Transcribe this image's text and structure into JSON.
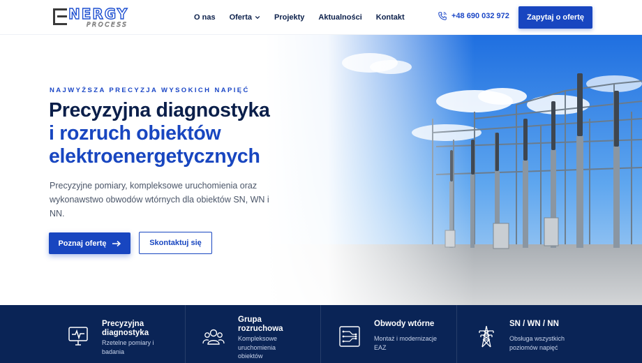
{
  "brand": {
    "logo_word": "NERGY",
    "logo_sub": "PROCESS"
  },
  "nav": {
    "items": [
      {
        "label": "O nas"
      },
      {
        "label": "Oferta",
        "has_dropdown": true
      },
      {
        "label": "Projekty"
      },
      {
        "label": "Aktualności"
      },
      {
        "label": "Kontakt"
      }
    ]
  },
  "header": {
    "phone": "+48 690 032 972",
    "phone_icon": "phone-icon",
    "cta_label": "Zapytaj o ofertę"
  },
  "hero": {
    "eyebrow": "NAJWYŻSZA PRECYZJA WYSOKICH NAPIĘĆ",
    "title_line1": "Precyzyjna diagnostyka",
    "title_line2": "i rozruch obiektów",
    "title_line3": "elektroenergetycznych",
    "lead": "Precyzyjne pomiary, kompleksowe uruchomienia oraz wykonawstwo obwodów wtórnych dla obiektów SN, WN i NN.",
    "primary_button": "Poznaj ofertę",
    "primary_button_icon": "arrow-right-icon",
    "secondary_button": "Skontaktuj się"
  },
  "features": [
    {
      "icon": "monitor-pulse-icon",
      "title": "Precyzyjna diagnostyka",
      "desc": "Rzetelne pomiary i badania"
    },
    {
      "icon": "team-icon",
      "title": "Grupa rozruchowa",
      "desc": "Kompleksowe uruchomienia obiektów"
    },
    {
      "icon": "circuit-board-icon",
      "title": "Obwody wtórne",
      "desc": "Montaż i modernizacje EAZ"
    },
    {
      "icon": "power-tower-icon",
      "title": "SN / WN / NN",
      "desc": "Obsługa wszystkich poziomów napięć"
    }
  ],
  "colors": {
    "primary": "#1846c0",
    "navy": "#0b1f4a",
    "features_bg": "#0a2456",
    "text_muted": "#4a5568"
  }
}
